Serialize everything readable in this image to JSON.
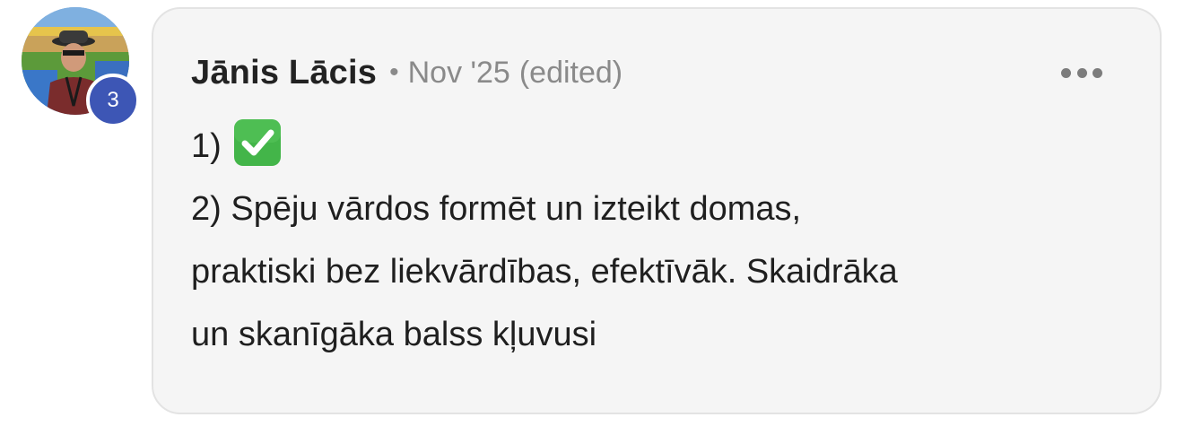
{
  "avatar": {
    "badge_count": "3"
  },
  "comment": {
    "author": "Jānis Lācis",
    "separator": "•",
    "date": "Nov '25",
    "edited": "(edited)",
    "lines": [
      "1)",
      "2) Spēju vārdos formēt un izteikt domas,",
      "praktiski bez liekvārdības, efektīvāk. Skaidrāka",
      "un skanīgāka balss kļuvusi"
    ],
    "emoji": "check-mark-button-icon"
  },
  "colors": {
    "bubble_background": "#f5f5f5",
    "badge": "#3d56b5",
    "check_green": "#43b549"
  }
}
